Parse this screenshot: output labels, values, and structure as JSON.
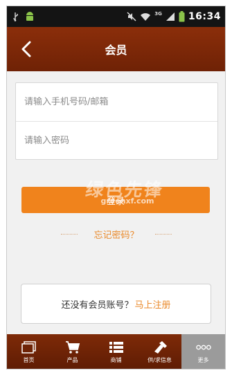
{
  "status_bar": {
    "time": "16:34",
    "network": "3G",
    "icons": [
      "usb-icon",
      "android-icon",
      "mute-icon",
      "wifi-icon",
      "signal-icon",
      "battery-icon"
    ]
  },
  "header": {
    "title": "会员",
    "back_icon": "chevron-left-icon"
  },
  "login_form": {
    "account_placeholder": "请输入手机号码/邮箱",
    "account_value": "",
    "password_placeholder": "请输入密码",
    "password_value": "",
    "login_label": "登录"
  },
  "forgot_password": "忘记密码？",
  "register": {
    "prompt": "还没有会员账号？",
    "link": "马上注册"
  },
  "watermark": {
    "text": "绿色先锋",
    "url": "greenxf.com"
  },
  "tabbar": {
    "active_index": 4,
    "tabs": [
      {
        "label": "首页",
        "icon": "home-icon"
      },
      {
        "label": "产品",
        "icon": "cart-icon"
      },
      {
        "label": "商铺",
        "icon": "list-icon"
      },
      {
        "label": "供/求信息",
        "icon": "handshake-icon"
      },
      {
        "label": "更多",
        "icon": "more-icon"
      }
    ]
  },
  "colors": {
    "header": "#7a2607",
    "accent": "#f0831c",
    "link": "#ea8a2b",
    "tab_active": "#9b9b9b"
  }
}
